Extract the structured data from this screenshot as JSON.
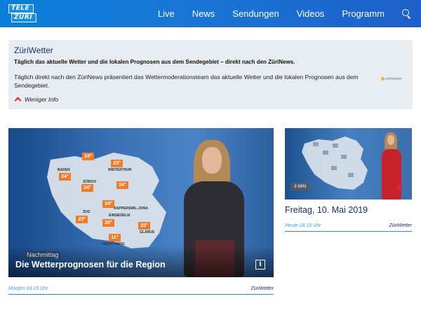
{
  "header": {
    "logo_line1": "TELE",
    "logo_line2": "ZÜRI",
    "nav": [
      "Live",
      "News",
      "Sendungen",
      "Videos",
      "Programm"
    ],
    "search_icon": "search-icon",
    "colors": {
      "header_start": "#0a7fd9",
      "header_end": "#1d5fc8"
    }
  },
  "infobox": {
    "title": "ZüriWetter",
    "subtitle": "Täglich das aktuelle Wetter und die lokalen Prognosen aus dem Sendegebiet – direkt nach den ZüriNews.",
    "description": "Täglich direkt nach den ZüriNews präsentiert das Wettermoderationsteam das aktuelle Wetter und die lokalen Prognosen aus dem Sendegebiet.",
    "sponsor_logo_text": "züriwetter",
    "toggle_label": "Weniger Info",
    "toggle_icon": "chevron-up-icon"
  },
  "main_video": {
    "map_temps": [
      "24°",
      "23°",
      "24°",
      "24°",
      "24°",
      "24°",
      "23°",
      "20°",
      "22°",
      "11°"
    ],
    "map_cities": [
      "BADEN",
      "WINTERTHUR",
      "ZÜRICH",
      "RAPPERSWIL-JONA",
      "ZUG",
      "EINSIEDELN",
      "GLARUS",
      "HOCH YBRIG"
    ],
    "overlay_label": "Nachmittag",
    "title": "Die Wetterprognosen für die Region",
    "info_icon": "i",
    "meta_time": "Morgen 18.15 Uhr",
    "meta_show": "ZüriWetter"
  },
  "side_video": {
    "duration": "3 MIN",
    "title": "Freitag, 10. Mai 2019",
    "meta_time": "Heute 18.15 Uhr",
    "meta_show": "ZüriWetter",
    "play_icon": "play-icon",
    "accent_color": "#e0262b"
  }
}
